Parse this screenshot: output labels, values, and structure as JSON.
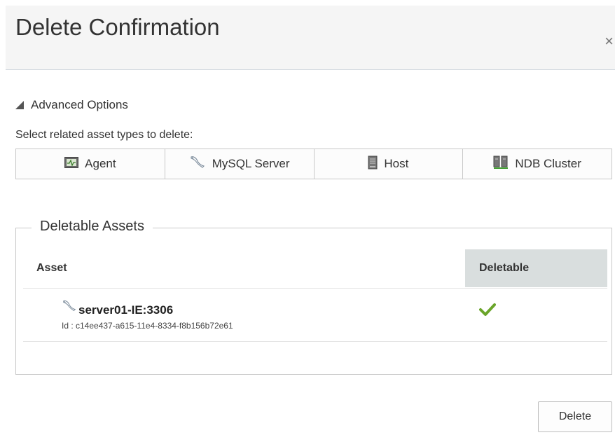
{
  "dialog": {
    "title": "Delete Confirmation",
    "close_label": "×"
  },
  "advanced": {
    "toggle_label": "Advanced Options",
    "select_label": "Select related asset types to delete:",
    "asset_types": [
      {
        "label": "Agent",
        "icon": "agent-icon"
      },
      {
        "label": "MySQL Server",
        "icon": "mysql-dolphin-icon"
      },
      {
        "label": "Host",
        "icon": "host-server-icon"
      },
      {
        "label": "NDB Cluster",
        "icon": "ndb-cluster-icon"
      }
    ]
  },
  "deletable": {
    "legend": "Deletable Assets",
    "headers": {
      "asset": "Asset",
      "deletable": "Deletable"
    },
    "rows": [
      {
        "name": "server01-IE:3306",
        "id": "Id : c14ee437-a615-11e4-8334-f8b156b72e61",
        "deletable": true,
        "icon": "mysql-dolphin-icon"
      }
    ]
  },
  "footer": {
    "delete_label": "Delete"
  },
  "colors": {
    "check": "#6aa52a",
    "header_bg": "#f5f5f5",
    "column_highlight": "#d9dede"
  }
}
